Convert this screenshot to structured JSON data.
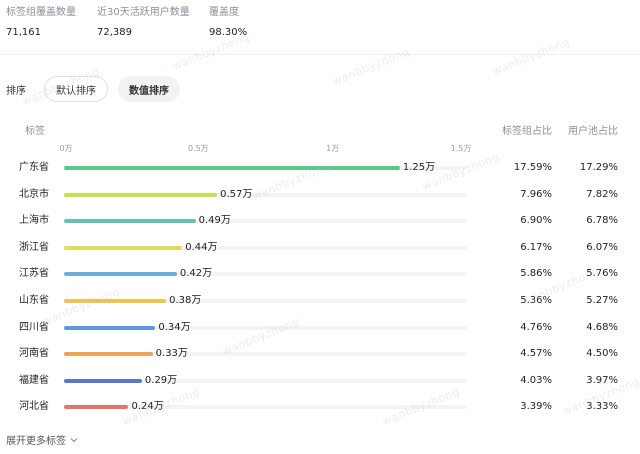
{
  "stats": [
    {
      "label": "标签组覆盖数量",
      "value": "71,161"
    },
    {
      "label": "近30天活跃用户数量",
      "value": "72,389"
    },
    {
      "label": "覆盖度",
      "value": "98.30%"
    }
  ],
  "sort": {
    "label": "排序",
    "default_label": "默认排序",
    "value_label": "数值排序",
    "active": "value"
  },
  "table": {
    "col_tag": "标签",
    "col_tag_ratio": "标签组占比",
    "col_user_ratio": "用户池占比"
  },
  "chart_data": {
    "type": "bar",
    "orientation": "horizontal",
    "xlim": [
      0,
      1.5
    ],
    "ticks": [
      "0万",
      "0.5万",
      "1万",
      "1.5万"
    ],
    "tick_values": [
      0,
      0.5,
      1,
      1.5
    ],
    "categories": [
      "广东省",
      "北京市",
      "上海市",
      "浙江省",
      "江苏省",
      "山东省",
      "四川省",
      "河南省",
      "福建省",
      "河北省"
    ],
    "values": [
      1.25,
      0.57,
      0.49,
      0.44,
      0.42,
      0.38,
      0.34,
      0.33,
      0.29,
      0.24
    ],
    "value_labels": [
      "1.25万",
      "0.57万",
      "0.49万",
      "0.44万",
      "0.42万",
      "0.38万",
      "0.34万",
      "0.33万",
      "0.29万",
      "0.24万"
    ],
    "tag_group_ratio": [
      "17.59%",
      "7.96%",
      "6.90%",
      "6.17%",
      "5.86%",
      "5.36%",
      "4.76%",
      "4.57%",
      "4.03%",
      "3.39%"
    ],
    "user_pool_ratio": [
      "17.29%",
      "7.82%",
      "6.78%",
      "6.07%",
      "5.76%",
      "5.27%",
      "4.68%",
      "4.50%",
      "3.97%",
      "3.33%"
    ],
    "colors": [
      "#5cc887",
      "#c9df52",
      "#63c2b8",
      "#e3dc5a",
      "#6eaedc",
      "#efc44f",
      "#5b97dc",
      "#eda455",
      "#5b78c8",
      "#e27569"
    ]
  },
  "footer": {
    "expand_label": "展开更多标签"
  },
  "watermark": "wanbbyzhong"
}
